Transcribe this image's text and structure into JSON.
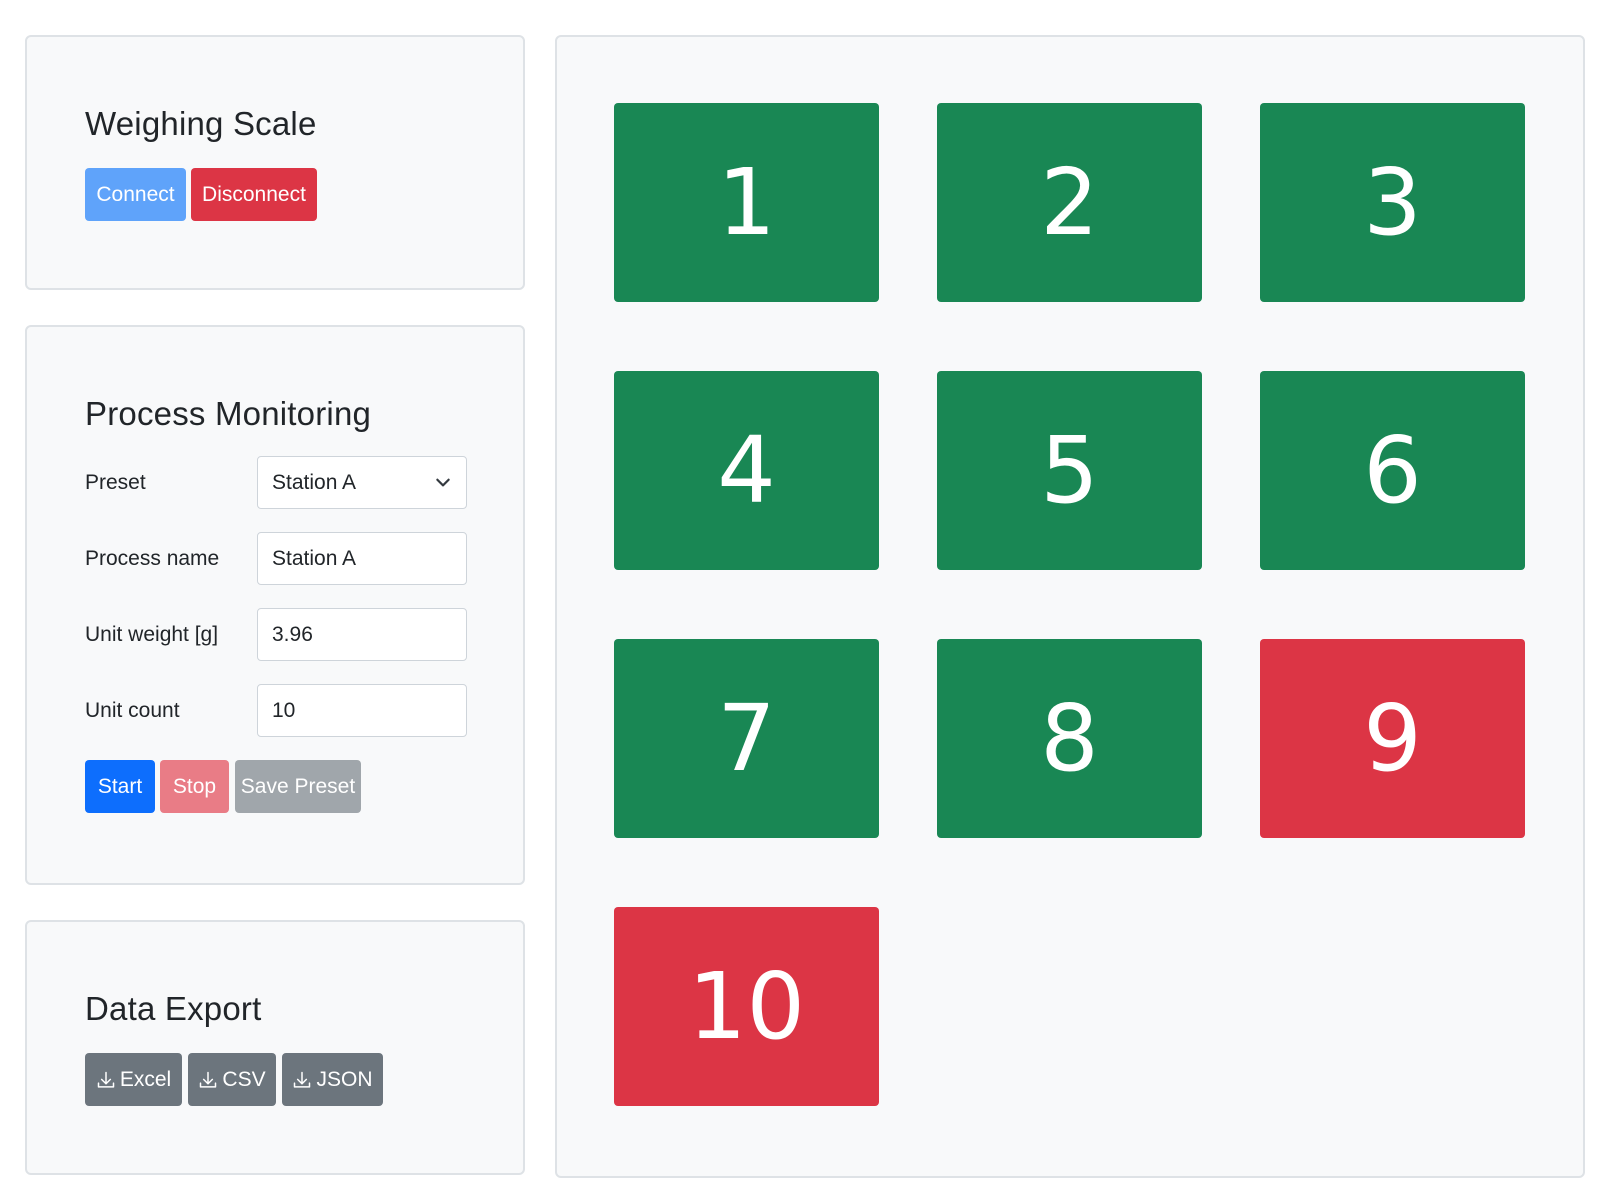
{
  "scale": {
    "title": "Weighing Scale",
    "connect_label": "Connect",
    "disconnect_label": "Disconnect"
  },
  "process": {
    "title": "Process Monitoring",
    "preset_label": "Preset",
    "preset_value": "Station A",
    "process_name_label": "Process name",
    "process_name_value": "Station A",
    "unit_weight_label": "Unit weight [g]",
    "unit_weight_value": "3.96",
    "unit_count_label": "Unit count",
    "unit_count_value": "10",
    "start_label": "Start",
    "stop_label": "Stop",
    "save_preset_label": "Save Preset"
  },
  "export": {
    "title": "Data Export",
    "buttons": [
      {
        "label": "Excel",
        "icon": "download-icon"
      },
      {
        "label": "CSV",
        "icon": "download-icon"
      },
      {
        "label": "JSON",
        "icon": "download-icon"
      }
    ]
  },
  "tiles": [
    {
      "label": "1",
      "status": "ok"
    },
    {
      "label": "2",
      "status": "ok"
    },
    {
      "label": "3",
      "status": "ok"
    },
    {
      "label": "4",
      "status": "ok"
    },
    {
      "label": "5",
      "status": "ok"
    },
    {
      "label": "6",
      "status": "ok"
    },
    {
      "label": "7",
      "status": "ok"
    },
    {
      "label": "8",
      "status": "ok"
    },
    {
      "label": "9",
      "status": "fail"
    },
    {
      "label": "10",
      "status": "fail"
    }
  ],
  "colors": {
    "ok": "#198754",
    "fail": "#dc3545",
    "primary": "#0d6efd",
    "secondary": "#6c757d"
  }
}
